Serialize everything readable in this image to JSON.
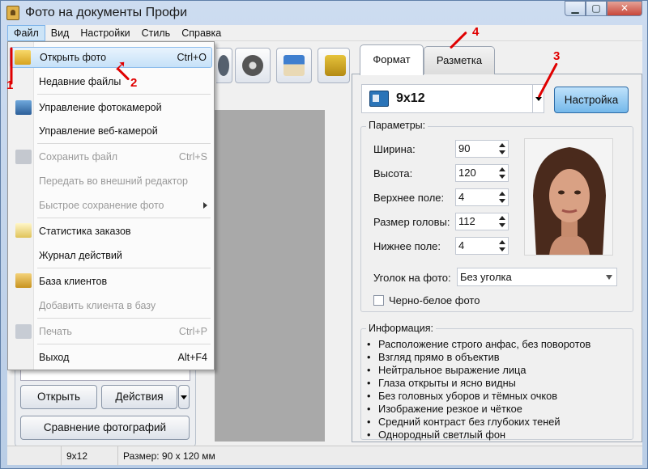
{
  "window": {
    "title": "Фото на документы Профи"
  },
  "menubar": [
    "Файл",
    "Вид",
    "Настройки",
    "Стиль",
    "Справка"
  ],
  "file_menu": {
    "items": [
      {
        "label": "Открыть фото",
        "shortcut": "Ctrl+O",
        "enabled": true,
        "highlighted": true
      },
      {
        "label": "Недавние файлы",
        "shortcut": "",
        "enabled": true
      },
      {
        "label": "Управление  фотокамерой",
        "shortcut": "",
        "enabled": true
      },
      {
        "label": "Управление веб-камерой",
        "shortcut": "",
        "enabled": true
      },
      {
        "label": "Сохранить файл",
        "shortcut": "Ctrl+S",
        "enabled": false
      },
      {
        "label": "Передать во внешний редактор",
        "shortcut": "",
        "enabled": false
      },
      {
        "label": "Быстрое сохранение фото",
        "shortcut": "",
        "enabled": false,
        "submenu": true
      },
      {
        "label": "Статистика заказов",
        "shortcut": "",
        "enabled": true
      },
      {
        "label": "Журнал действий",
        "shortcut": "",
        "enabled": true
      },
      {
        "label": "База клиентов",
        "shortcut": "",
        "enabled": true
      },
      {
        "label": "Добавить клиента в базу",
        "shortcut": "",
        "enabled": false
      },
      {
        "label": "Печать",
        "shortcut": "Ctrl+P",
        "enabled": false
      },
      {
        "label": "Выход",
        "shortcut": "Alt+F4",
        "enabled": true
      }
    ]
  },
  "left_buttons": {
    "open": "Открыть",
    "actions": "Действия",
    "compare": "Сравнение фотографий"
  },
  "statusbar": {
    "format": "9x12",
    "size": "Размер: 90 x 120 мм"
  },
  "tabs": [
    "Формат",
    "Разметка"
  ],
  "format": {
    "selected": "9x12",
    "setup_button": "Настройка"
  },
  "parameters": {
    "title": "Параметры:",
    "fields": [
      {
        "label": "Ширина:",
        "value": "90"
      },
      {
        "label": "Высота:",
        "value": "120"
      },
      {
        "label": "Верхнее поле:",
        "value": "4"
      },
      {
        "label": "Размер головы:",
        "value": "112"
      },
      {
        "label": "Нижнее поле:",
        "value": "4"
      }
    ],
    "corner_label": "Уголок на фото:",
    "corner_value": "Без уголка",
    "bw_label": "Черно-белое фото",
    "bw_checked": false
  },
  "info": {
    "title": "Информация:",
    "items": [
      "Расположение строго анфас, без поворотов",
      "Взгляд прямо в объектив",
      "Нейтральное выражение лица",
      "Глаза открыты и ясно видны",
      "Без головных уборов и тёмных очков",
      "Изображение резкое и чёткое",
      "Средний контраст без глубоких теней",
      "Однородный светлый фон"
    ]
  },
  "annotations": [
    "1",
    "2",
    "3",
    "4"
  ],
  "colors": {
    "accent": "#74b8ea",
    "annotation": "#e00000",
    "preview": "#a9a9a9"
  }
}
